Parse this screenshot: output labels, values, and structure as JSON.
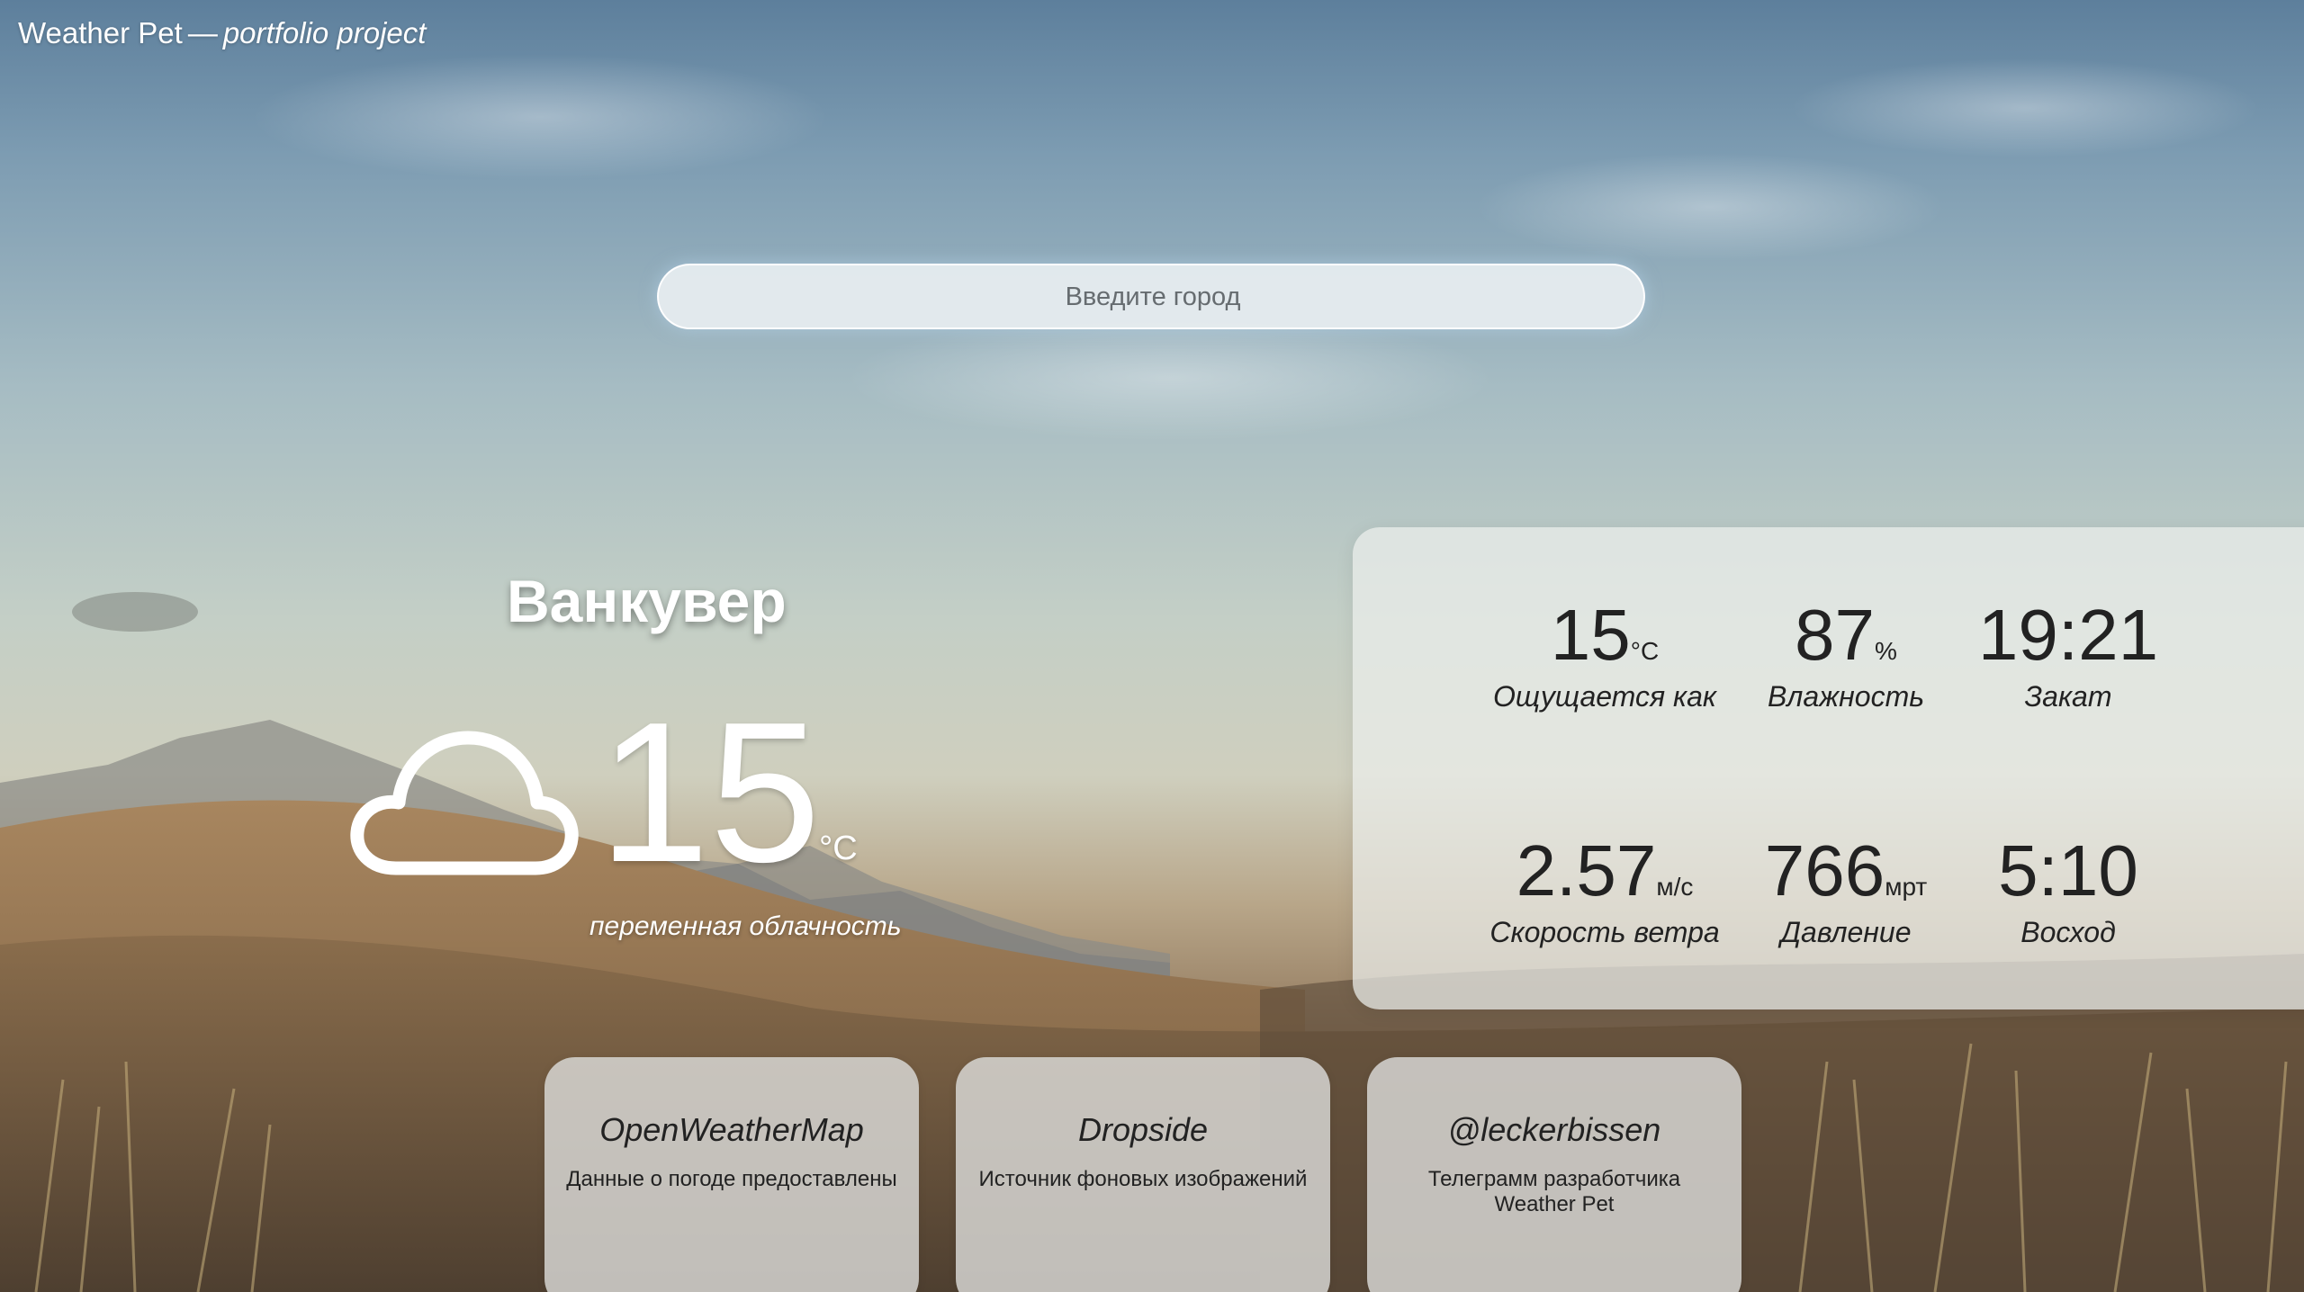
{
  "brand": {
    "title": "Weather Pet",
    "separator": "—",
    "subtitle": "portfolio project"
  },
  "search": {
    "placeholder": "Введите город",
    "value": ""
  },
  "current": {
    "city": "Ванкувер",
    "icon": "cloud-icon",
    "temperature": "15",
    "unit": "°C",
    "description": "переменная облачность"
  },
  "details": [
    {
      "value": "15",
      "unit": "°C",
      "label": "Ощущается как"
    },
    {
      "value": "87",
      "unit": "%",
      "label": "Влажность"
    },
    {
      "value": "19:21",
      "unit": "",
      "label": "Закат"
    },
    {
      "value": "2.57",
      "unit": "м/с",
      "label": "Скорость ветра"
    },
    {
      "value": "766",
      "unit": "мрт",
      "label": "Давление"
    },
    {
      "value": "5:10",
      "unit": "",
      "label": "Восход"
    }
  ],
  "cards": [
    {
      "title": "OpenWeatherMap",
      "text": "Данные о погоде предоставлены"
    },
    {
      "title": "Dropside",
      "text": "Источник фоновых изображений"
    },
    {
      "title": "@leckerbissen",
      "text": "Телеграмм разработчика Weather Pet"
    }
  ],
  "colors": {
    "panel": "#eceeec",
    "card": "#dadad8",
    "text_light": "#ffffff",
    "text_dark": "#222222"
  }
}
